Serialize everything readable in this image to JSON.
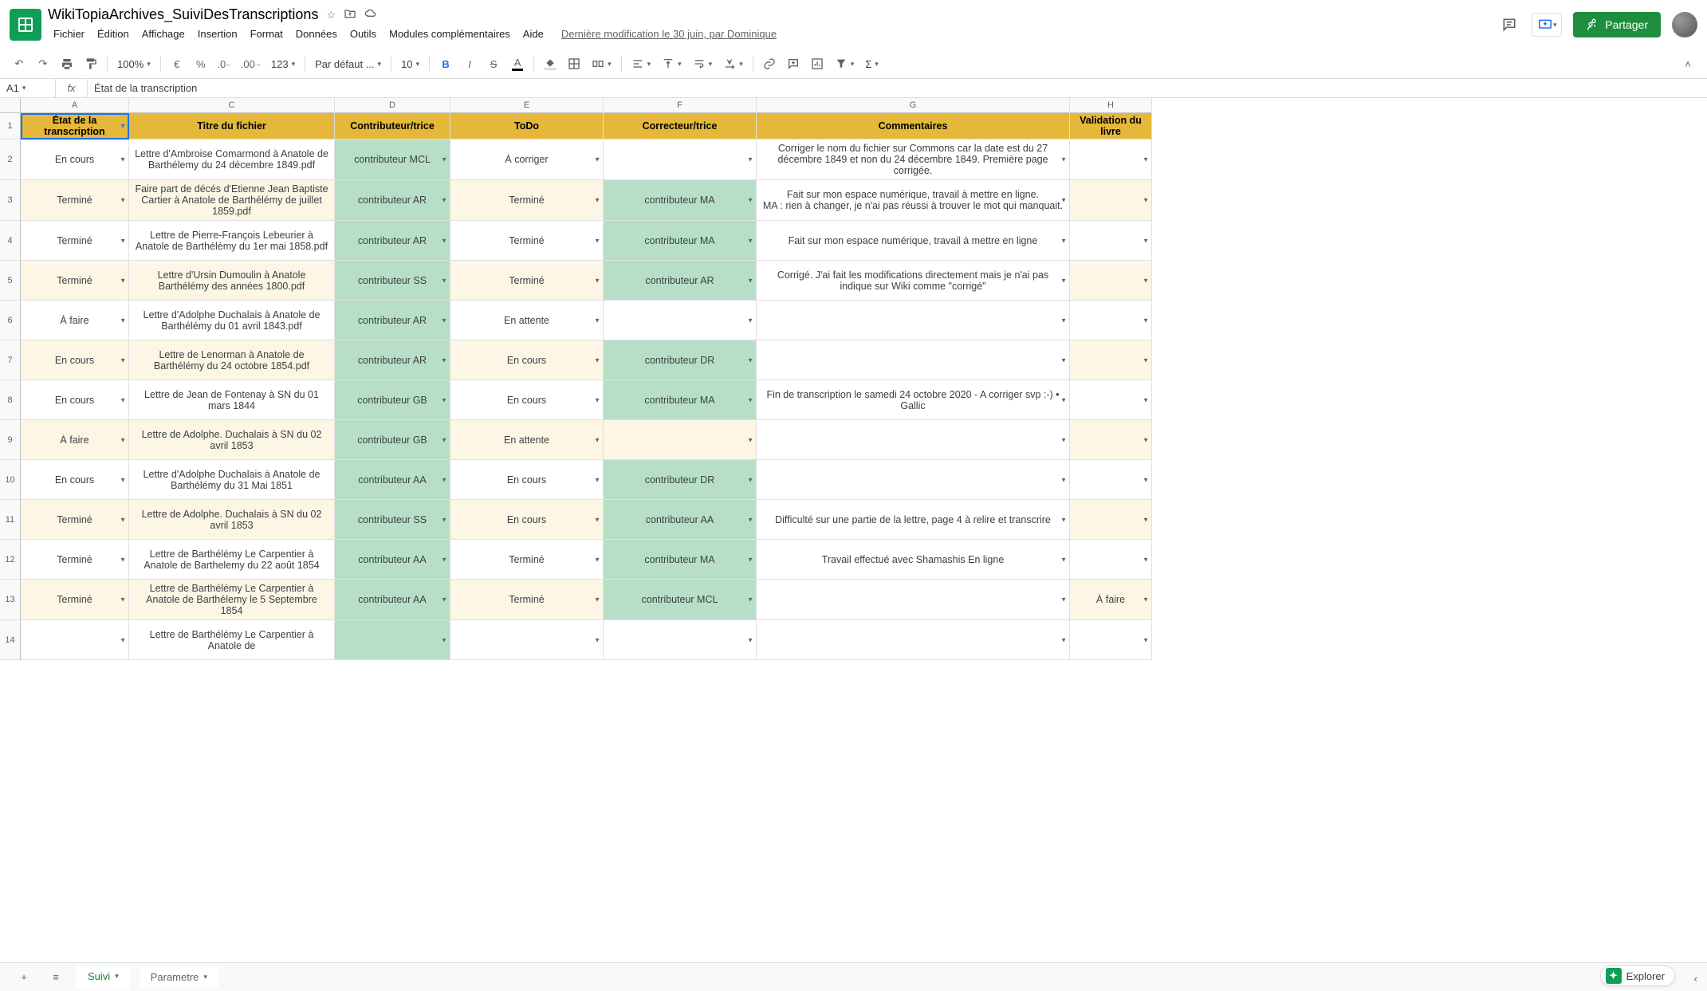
{
  "doc": {
    "title": "WikiTopiaArchives_SuiviDesTranscriptions"
  },
  "menus": [
    "Fichier",
    "Édition",
    "Affichage",
    "Insertion",
    "Format",
    "Données",
    "Outils",
    "Modules complémentaires",
    "Aide"
  ],
  "last_edit": "Dernière modification le 30 juin, par Dominique",
  "share_label": "Partager",
  "toolbar": {
    "zoom": "100%",
    "currency": "€",
    "percent": "%",
    "number_format": "123",
    "font": "Par défaut ...",
    "font_size": "10"
  },
  "namebox": "A1",
  "formula": "État de la transcription",
  "columns": [
    "A",
    "C",
    "D",
    "E",
    "F",
    "G",
    "H"
  ],
  "headers": {
    "A": "État de la transcription",
    "C": "Titre du fichier",
    "D": "Contributeur/trice",
    "E": "ToDo",
    "F": "Correcteur/trice",
    "G": "Commentaires",
    "H": "Validation du livre"
  },
  "rows": [
    {
      "n": "2",
      "alt": false,
      "A": "En cours",
      "C": "Lettre d'Ambroise Comarmond à Anatole de Barthélemy du 24 décembre 1849.pdf",
      "D": "contributeur MCL",
      "E": "À corriger",
      "F": "",
      "G": "Corriger le nom du fichier sur Commons car la date est du 27 décembre 1849 et non du 24 décembre 1849. Première page corrigée.",
      "H": ""
    },
    {
      "n": "3",
      "alt": true,
      "A": "Terminé",
      "C": "Faire part de décés d'Etienne Jean Baptiste Cartier à Anatole de Barthélémy de juillet 1859.pdf",
      "D": "contributeur AR",
      "E": "Terminé",
      "F": "contributeur MA",
      "G": "Fait sur mon espace numérique, travail à mettre en ligne.\nMA : rien à changer, je n'ai pas réussi à trouver le mot qui manquait.",
      "H": ""
    },
    {
      "n": "4",
      "alt": false,
      "A": "Terminé",
      "C": "Lettre de Pierre-François Lebeurier à Anatole de Barthélémy du 1er mai 1858.pdf",
      "D": "contributeur AR",
      "E": "Terminé",
      "F": "contributeur MA",
      "G": "Fait sur mon espace numérique, travail à mettre en ligne",
      "H": ""
    },
    {
      "n": "5",
      "alt": true,
      "A": "Terminé",
      "C": "Lettre d'Ursin Dumoulin à Anatole Barthélémy des années 1800.pdf",
      "D": "contributeur SS",
      "E": "Terminé",
      "F": "contributeur AR",
      "G": "Corrigé. J'ai fait les modifications directement mais je n'ai pas indique sur Wiki comme \"corrigé\"",
      "H": ""
    },
    {
      "n": "6",
      "alt": false,
      "A": "À faire",
      "C": "Lettre d'Adolphe Duchalais à Anatole de Barthélémy du 01 avril 1843.pdf",
      "D": "contributeur AR",
      "E": "En attente",
      "F": "",
      "G": "",
      "H": ""
    },
    {
      "n": "7",
      "alt": true,
      "A": "En cours",
      "C": "Lettre de Lenorman à Anatole de Barthélémy du 24 octobre 1854.pdf",
      "D": "contributeur AR",
      "E": "En cours",
      "F": "contributeur DR",
      "G": "",
      "H": ""
    },
    {
      "n": "8",
      "alt": false,
      "A": "En cours",
      "C": "Lettre de Jean de Fontenay à SN du 01 mars 1844",
      "D": "contributeur GB",
      "E": "En cours",
      "F": "contributeur MA",
      "G": "Fin de transcription le samedi 24 octobre 2020 - A corriger svp :-) • Gallic",
      "H": ""
    },
    {
      "n": "9",
      "alt": true,
      "A": "À faire",
      "C": "Lettre de Adolphe. Duchalais à SN du 02 avril 1853",
      "D": "contributeur GB",
      "E": "En attente",
      "F": "",
      "G": "",
      "H": ""
    },
    {
      "n": "10",
      "alt": false,
      "A": "En cours",
      "C": "Lettre d'Adolphe Duchalais à Anatole de Barthélémy du 31 Mai 1851",
      "D": "contributeur AA",
      "E": "En cours",
      "F": "contributeur DR",
      "G": "",
      "H": ""
    },
    {
      "n": "11",
      "alt": true,
      "A": "Terminé",
      "C": "Lettre de Adolphe. Duchalais à SN du 02 avril 1853",
      "D": "contributeur SS",
      "E": "En cours",
      "F": "contributeur AA",
      "G": "Difficulté sur une partie de la lettre, page 4 à relire et transcrire",
      "H": ""
    },
    {
      "n": "12",
      "alt": false,
      "A": "Terminé",
      "C": "Lettre de Barthélémy Le Carpentier à Anatole de Barthelemy du 22 août 1854",
      "D": "contributeur AA",
      "E": "Terminé",
      "F": "contributeur MA",
      "G": "Travail effectué avec Shamashis En ligne",
      "H": ""
    },
    {
      "n": "13",
      "alt": true,
      "A": "Terminé",
      "C": "Lettre de Barthélémy Le Carpentier à Anatole de Barthélemy le 5 Septembre 1854",
      "D": "contributeur AA",
      "E": "Terminé",
      "F": "contributeur MCL",
      "G": "",
      "H": "À faire"
    },
    {
      "n": "14",
      "alt": false,
      "A": "",
      "C": "Lettre de Barthélémy Le Carpentier à Anatole de",
      "D": "",
      "E": "",
      "F": "",
      "G": "",
      "H": ""
    }
  ],
  "sheets": {
    "active": "Suivi",
    "other": "Parametre"
  },
  "explore_label": "Explorer"
}
